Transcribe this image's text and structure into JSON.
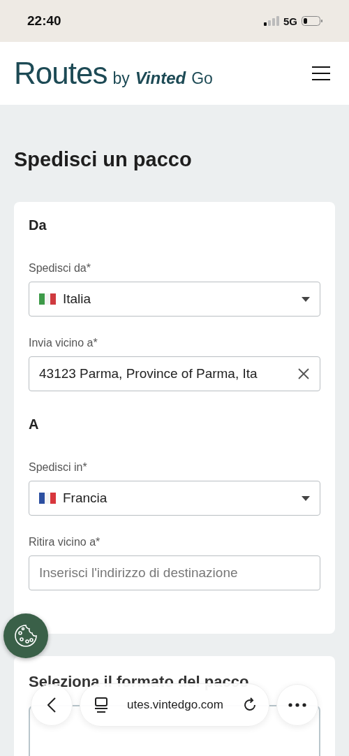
{
  "status_bar": {
    "time": "22:40",
    "network": "5G"
  },
  "header": {
    "brand": "Routes",
    "by": "by",
    "partner": "Vinted",
    "partner_suffix": "Go"
  },
  "page_title": "Spedisci un pacco",
  "sections": [
    {
      "heading": "Da",
      "fields": [
        {
          "kind": "select",
          "label": "Spedisci da*",
          "value": "Italia",
          "flag_stripes": [
            {
              "color": "#3d9a48"
            },
            {
              "color": "#f4f4f4"
            },
            {
              "color": "#cf3a3f"
            }
          ]
        },
        {
          "kind": "input",
          "label": "Invia vicino a*",
          "value": "43123 Parma, Province of Parma, Ita",
          "clearable": true
        }
      ]
    },
    {
      "heading": "A",
      "fields": [
        {
          "kind": "select",
          "label": "Spedisci in*",
          "value": "Francia",
          "flag_stripes": [
            {
              "color": "#2c4fa0"
            },
            {
              "color": "#f4f4f4"
            },
            {
              "color": "#d8373d"
            }
          ]
        },
        {
          "kind": "input",
          "label": "Ritira vicino a*",
          "placeholder": "Inserisci l'indirizzo di destinazione",
          "clearable": false
        }
      ]
    }
  ],
  "format_card": {
    "title": "Seleziona il formato del pacco"
  },
  "browser_bar": {
    "url": "utes.vintedgo.com"
  }
}
